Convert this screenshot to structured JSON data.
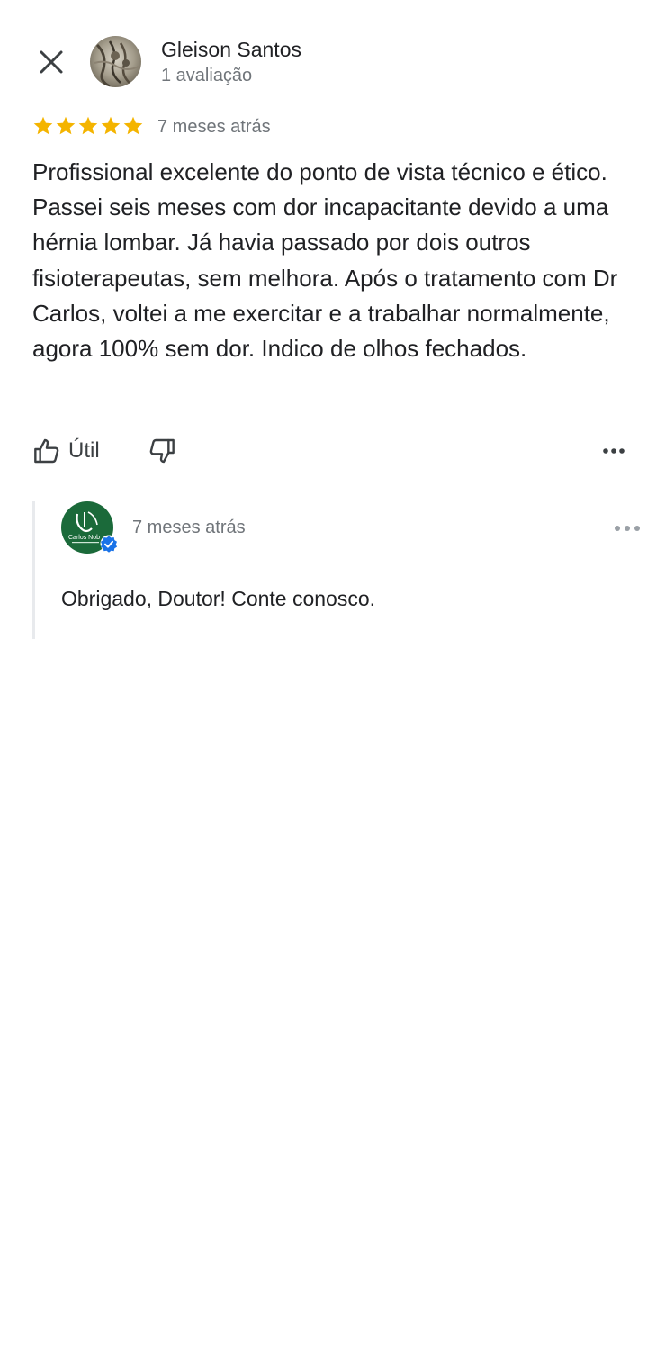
{
  "review": {
    "reviewer_name": "Gleison Santos",
    "reviewer_review_count": "1 avaliação",
    "rating": 5,
    "rating_max": 5,
    "date": "7 meses atrás",
    "text": "Profissional excelente do ponto de vista técnico e ético. Passei seis meses com dor incapacitante devido a uma hérnia lombar. Já havia passado por dois outros fisioterapeutas, sem melhora. Após o tratamento com Dr Carlos, voltei a me exercitar e a trabalhar normalmente, agora 100% sem dor. Indico de olhos fechados."
  },
  "actions": {
    "helpful_label": "Útil",
    "helpful_icon": "thumbs-up-icon",
    "unhelpful_icon": "thumbs-down-icon",
    "more_icon": "more-horizontal-icon",
    "close_icon": "close-icon"
  },
  "owner_reply": {
    "date": "7 meses atrás",
    "text": "Obrigado, Doutor! Conte conosco.",
    "avatar_logo_text": "Carlos Nob",
    "verified_icon": "verified-badge-icon"
  },
  "colors": {
    "star": "#f4b400",
    "text_primary": "#202124",
    "text_secondary": "#70757a",
    "reply_border": "#e8eaed",
    "verified_blue": "#1a73e8",
    "owner_avatar_green": "#1b6a3a"
  }
}
